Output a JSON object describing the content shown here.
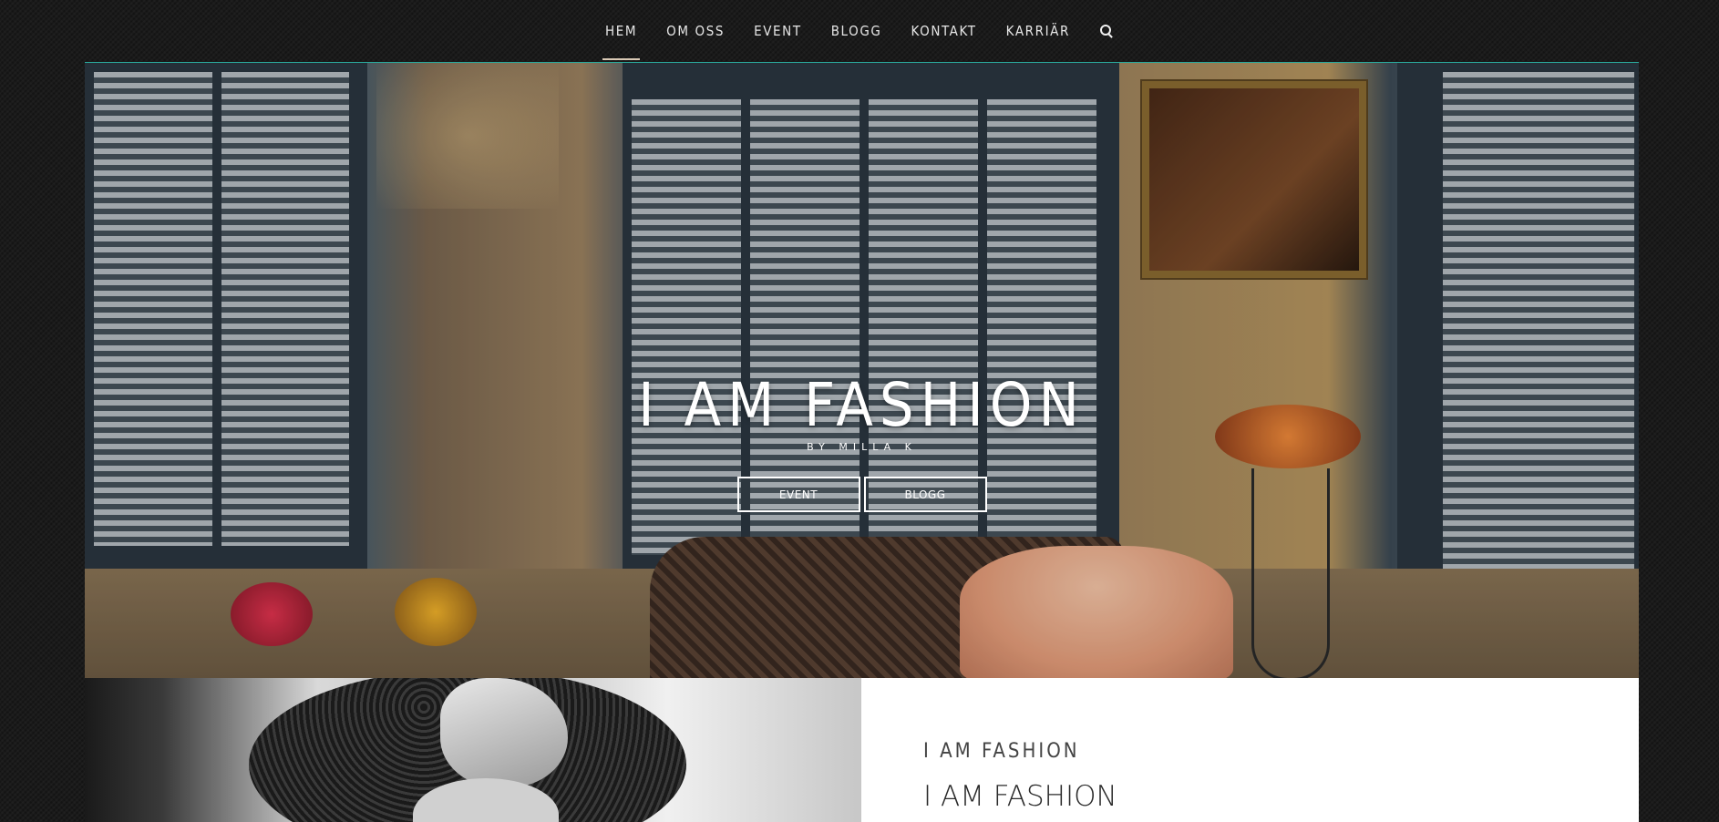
{
  "nav": {
    "items": [
      {
        "label": "HEM",
        "active": true
      },
      {
        "label": "OM OSS"
      },
      {
        "label": "EVENT"
      },
      {
        "label": "BLOGG"
      },
      {
        "label": "KONTAKT"
      },
      {
        "label": "KARRIÄR"
      }
    ],
    "search_icon": "search-icon"
  },
  "hero": {
    "title": "I AM FASHION",
    "subtitle": "BY MILLA K",
    "buttons": [
      "EVENT",
      "BLOGG"
    ]
  },
  "section": {
    "kicker": "I AM FASHION",
    "heading": "I AM FASHION"
  },
  "colors": {
    "background": "#1b1b1b",
    "accent_line": "#2aa89b",
    "text_light": "#ffffff",
    "text_dark": "#2a2a2a"
  }
}
